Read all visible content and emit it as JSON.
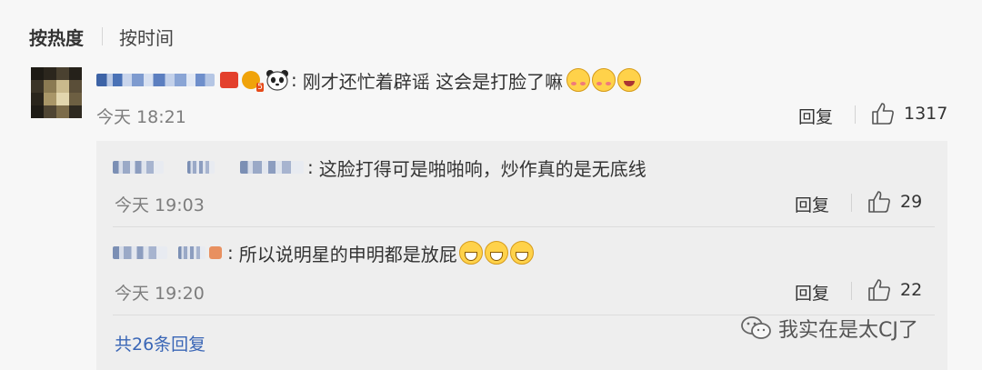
{
  "sort": {
    "hot_label": "按热度",
    "time_label": "按时间"
  },
  "comment": {
    "username_blurred": true,
    "text": "刚才还忙着辟谣 这会是打脸了嘛",
    "time": "今天 18:21",
    "reply_label": "回复",
    "likes": "1317",
    "badge_level": "5",
    "emojis": [
      "blush-emoji",
      "blush-emoji",
      "laugh-cry-emoji"
    ]
  },
  "replies": [
    {
      "text": "这脸打得可是啪啪响，炒作真的是无底线",
      "time": "今天 19:03",
      "reply_label": "回复",
      "likes": "29"
    },
    {
      "text": "所以说明星的申明都是放屁",
      "time": "今天 19:20",
      "reply_label": "回复",
      "likes": "22",
      "emojis": [
        "grin-emoji",
        "grin-emoji",
        "grin-emoji"
      ]
    }
  ],
  "total_replies": "共26条回复",
  "watermark": "我实在是太CJ了",
  "colors": {
    "link": "#3a66b6",
    "name_blue": "#4a72b6",
    "background": "#f7f7f7",
    "reply_bg": "#eeeeee"
  }
}
